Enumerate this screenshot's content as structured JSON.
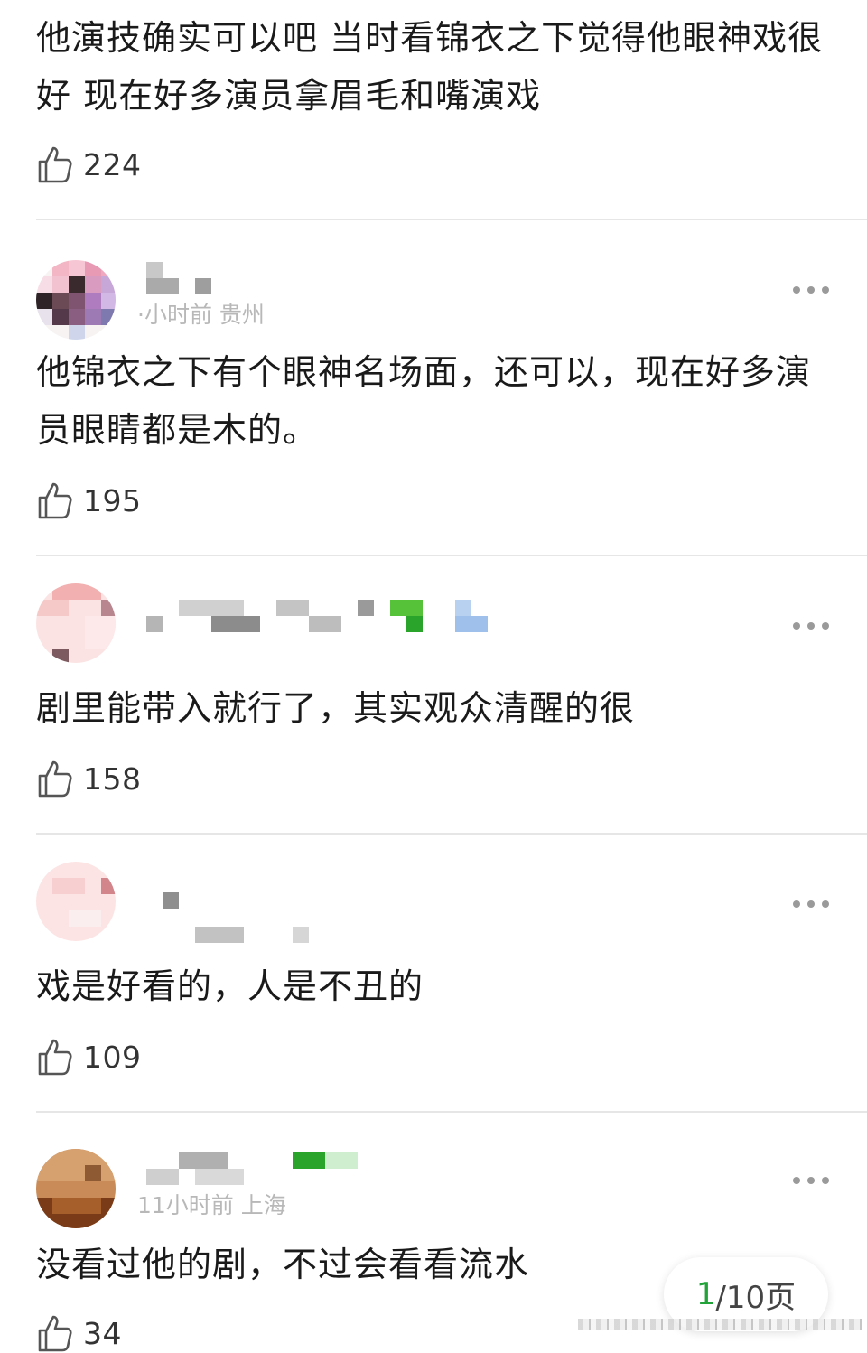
{
  "comments": [
    {
      "text": "他演技确实可以吧 当时看锦衣之下觉得他眼神戏很好 现在好多演员拿眉毛和嘴演戏",
      "likes": "224"
    },
    {
      "meta": "·小时前 贵州",
      "text": "他锦衣之下有个眼神名场面，还可以，现在好多演员眼睛都是木的。",
      "likes": "195"
    },
    {
      "meta": "",
      "text": "剧里能带入就行了，其实观众清醒的很",
      "likes": "158"
    },
    {
      "meta": "",
      "text": "戏是好看的，人是不丑的",
      "likes": "109"
    },
    {
      "meta": "11小时前 上海",
      "text": "没看过他的剧，不过会看看流水",
      "likes": "34"
    }
  ],
  "pager": {
    "current": "1",
    "total": "/10页"
  },
  "icons": {
    "like": "thumbs-up-icon",
    "more": "more-dots-icon"
  },
  "colors": {
    "accent": "#21a33a",
    "meta": "#b8b8b8",
    "divider": "#e6e6e6"
  }
}
